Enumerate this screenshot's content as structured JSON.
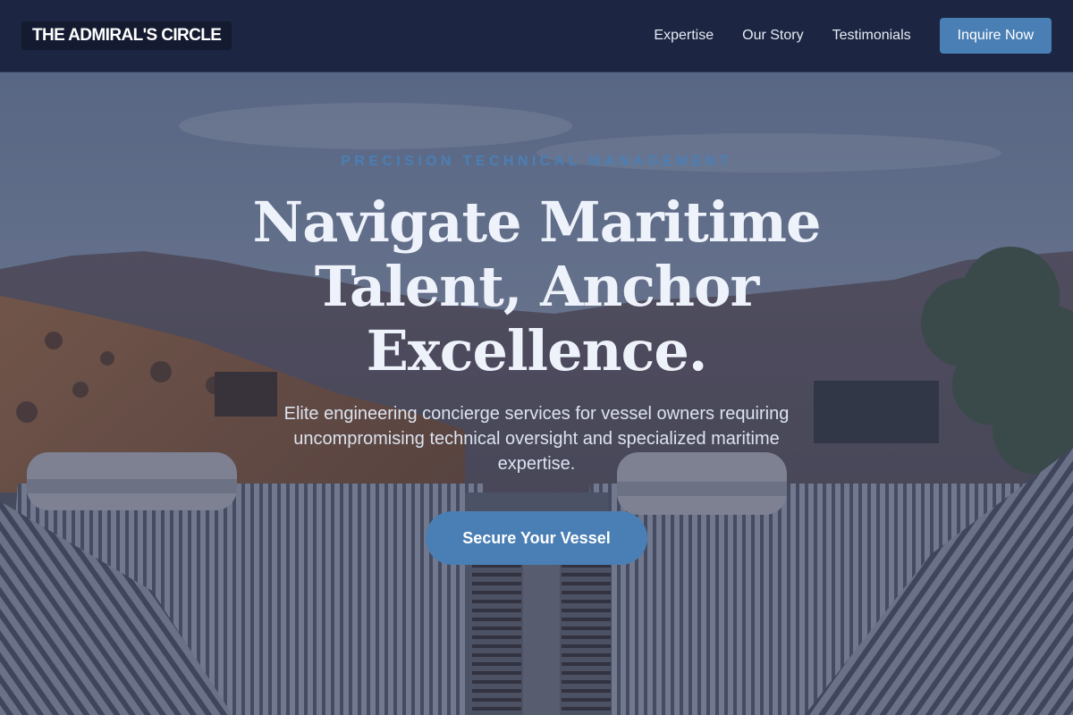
{
  "brand": {
    "name": "THE ADMIRAL'S CIRCLE"
  },
  "nav": {
    "links": [
      "Expertise",
      "Our Story",
      "Testimonials"
    ],
    "cta_label": "Inquire Now"
  },
  "hero": {
    "eyebrow": "PRECISION TECHNICAL MANAGEMENT",
    "headline": "Navigate Maritime Talent, Anchor Excellence.",
    "subtext": "Elite engineering concierge services for vessel owners requiring uncompromising technical oversight and specialized maritime expertise.",
    "cta_label": "Secure Your Vessel",
    "background_description": ""
  },
  "colors": {
    "header_bg": "#1c2541",
    "accent": "#4a7fb5",
    "text_light": "#eef2fa"
  }
}
